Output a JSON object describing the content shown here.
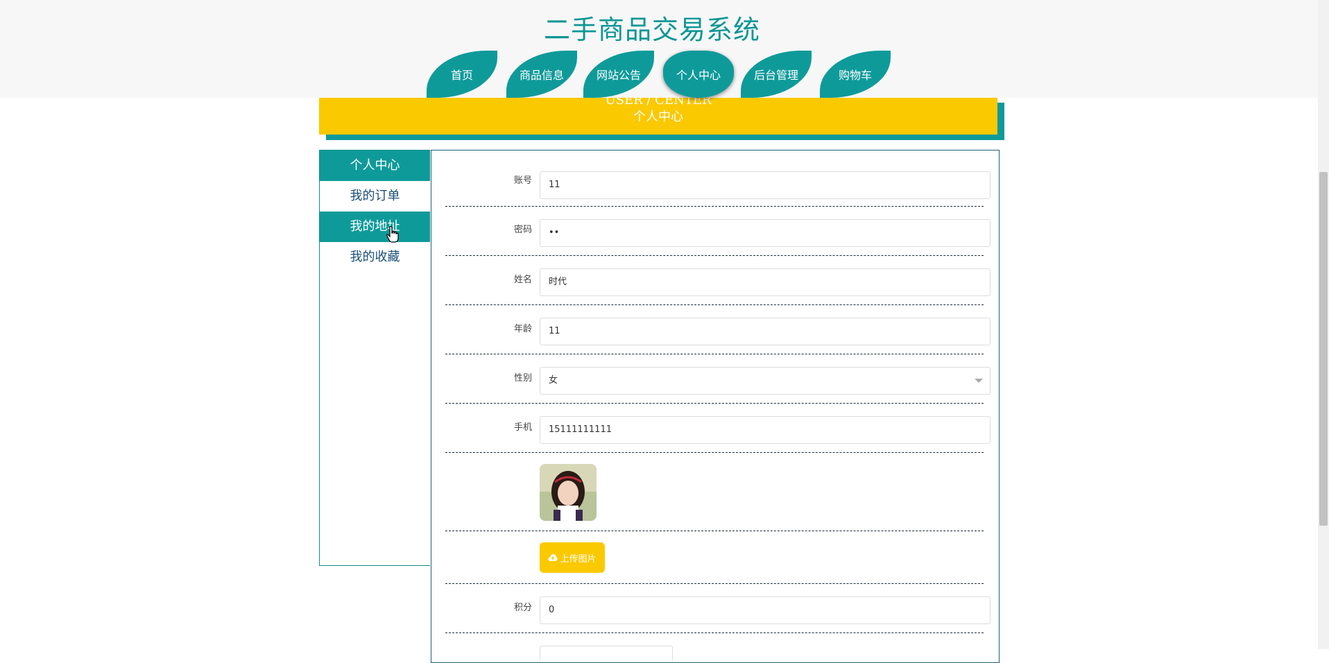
{
  "header": {
    "site_title": "二手商品交易系统",
    "nav": [
      {
        "label": "首页",
        "active": false
      },
      {
        "label": "商品信息",
        "active": false
      },
      {
        "label": "网站公告",
        "active": false
      },
      {
        "label": "个人中心",
        "active": true
      },
      {
        "label": "后台管理",
        "active": false
      },
      {
        "label": "购物车",
        "active": false
      }
    ]
  },
  "banner": {
    "subtitle_en": "USER / CENTER",
    "title": "个人中心"
  },
  "sidebar": {
    "items": [
      {
        "label": "个人中心",
        "active": true
      },
      {
        "label": "我的订单",
        "active": false
      },
      {
        "label": "我的地址",
        "active": true
      },
      {
        "label": "我的收藏",
        "active": false
      }
    ]
  },
  "form": {
    "account": {
      "label": "账号",
      "value": "11"
    },
    "password": {
      "label": "密码",
      "value": "••"
    },
    "name": {
      "label": "姓名",
      "value": "时代"
    },
    "age": {
      "label": "年龄",
      "value": "11"
    },
    "gender": {
      "label": "性别",
      "value": "女"
    },
    "phone": {
      "label": "手机",
      "value": "15111111111"
    },
    "upload_button": {
      "label": "上传图片",
      "icon": "cloud-upload-icon"
    },
    "points": {
      "label": "积分",
      "value": "0"
    }
  },
  "colors": {
    "teal": "#0f9a9a",
    "yellow": "#fbc900",
    "header_bg": "#f7f7f7"
  }
}
